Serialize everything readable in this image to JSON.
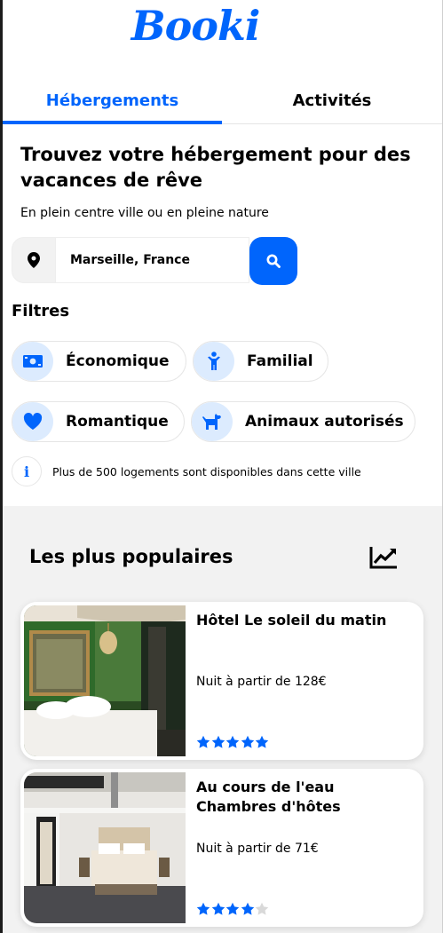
{
  "logo": {
    "text": "Booki"
  },
  "tabs": [
    {
      "label": "Hébergements",
      "active": true
    },
    {
      "label": "Activités",
      "active": false
    }
  ],
  "search": {
    "headline": "Trouvez votre hébergement pour des vacances de rêve",
    "subline": "En plein centre ville ou en pleine nature",
    "city_value": "Marseille, France",
    "location_icon": "map-pin-icon",
    "button_icon": "search-icon"
  },
  "filters": {
    "title": "Filtres",
    "items": [
      {
        "label": "Économique",
        "icon": "money-icon"
      },
      {
        "label": "Familial",
        "icon": "child-icon"
      },
      {
        "label": "Romantique",
        "icon": "heart-icon"
      },
      {
        "label": "Animaux autorisés",
        "icon": "dog-icon"
      }
    ]
  },
  "info": {
    "text": "Plus de 500 logements sont disponibles dans cette ville",
    "icon": "info-icon"
  },
  "popular": {
    "title": "Les plus populaires",
    "icon": "trend-chart-icon",
    "cards": [
      {
        "name": "Hôtel Le soleil du matin",
        "price": "Nuit à partir de 128€",
        "rating": 5
      },
      {
        "name": "Au cours de l'eau Chambres d'hôtes",
        "price": "Nuit à partir de 71€",
        "rating": 4
      }
    ]
  },
  "colors": {
    "accent": "#0065fc",
    "chip_icon_bg": "#dcebfe",
    "section_bg": "#f2f2f2",
    "star_empty": "#d9d9d9"
  }
}
